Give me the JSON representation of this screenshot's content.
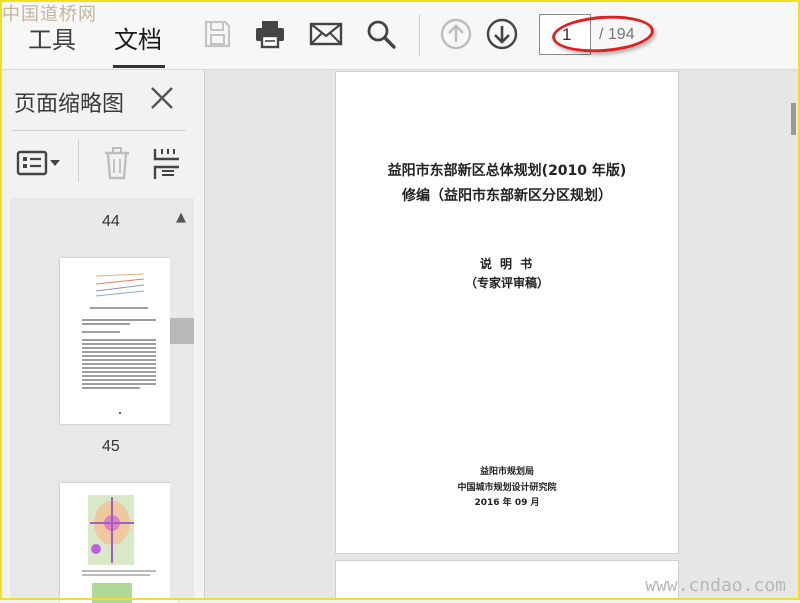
{
  "watermarks": {
    "top": "中国道桥网",
    "bottom": "www.cndao.com"
  },
  "toolbar": {
    "tabs": [
      {
        "label": "工具"
      },
      {
        "label": "文档"
      }
    ],
    "icons": [
      "save-icon",
      "print-icon",
      "email-icon",
      "search-icon",
      "arrow-up-icon",
      "arrow-down-icon"
    ],
    "current_page": "1",
    "total_pages": "/ 194"
  },
  "sidebar": {
    "title": "页面缩略图",
    "icons": [
      "options-menu-icon",
      "trash-icon",
      "extract-page-icon",
      "close-icon"
    ],
    "page_labels": [
      "44",
      "45"
    ]
  },
  "document": {
    "title_line1": "益阳市东部新区总体规划(2010 年版)",
    "title_line2": "修编（益阳市东部新区分区规划）",
    "subtitle": "说 明 书",
    "subtitle2": "（专家评审稿）",
    "org1": "益阳市规划局",
    "org2": "中国城市规划设计研究院",
    "date": "2016 年 09 月"
  },
  "colors": {
    "accent_red": "#e02020",
    "frame_yellow": "#f0e020"
  }
}
